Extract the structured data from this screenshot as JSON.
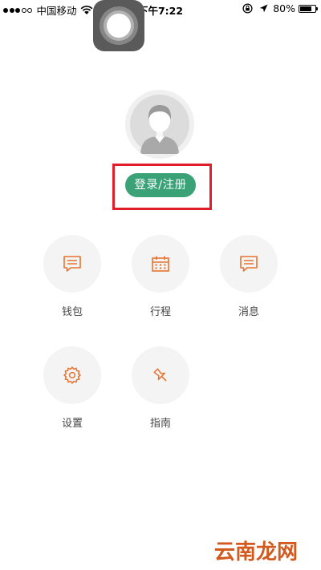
{
  "status_bar": {
    "carrier": "中国移动",
    "time": "下午7:22",
    "battery": "80%",
    "battery_level": 0.8
  },
  "login_label": "登录/注册",
  "colors": {
    "accent_green": "#3aa276",
    "icon_orange": "#e8732f",
    "highlight_red": "#e01e2a"
  },
  "menu": [
    {
      "label": "钱包",
      "icon": "chat-bubble-icon"
    },
    {
      "label": "行程",
      "icon": "calendar-icon"
    },
    {
      "label": "消息",
      "icon": "chat-bubble-icon"
    },
    {
      "label": "设置",
      "icon": "gear-icon"
    },
    {
      "label": "指南",
      "icon": "pushpin-icon"
    }
  ],
  "watermark": "云南龙网"
}
